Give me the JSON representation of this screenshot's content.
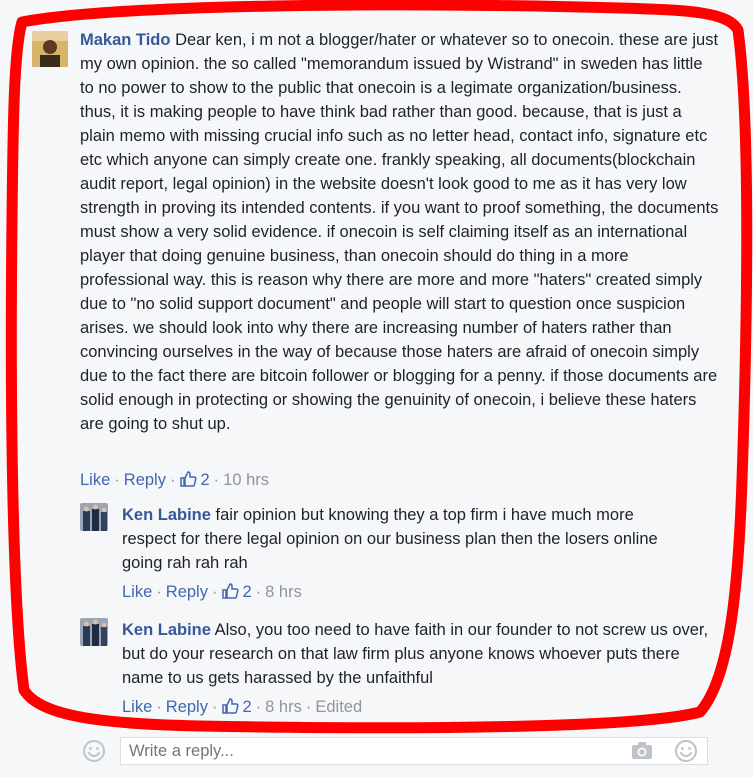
{
  "comments": [
    {
      "author": "Makan Tido",
      "text": "Dear ken, i m not a blogger/hater or whatever so to onecoin. these are just my own opinion. the so called \"memorandum issued by Wistrand\" in sweden has little to no power to show to the public that onecoin is a legimate organization/business. thus, it is making people to have think bad rather than good. because, that is just a plain memo with missing crucial info such as no letter head, contact info, signature etc etc which anyone can simply create one. frankly speaking, all documents(blockchain audit report, legal opinion) in the website doesn't look good to me as it has very low strength in proving its intended contents. if you want to proof something, the documents must show a very solid evidence. if onecoin is self claiming itself as an international player that doing genuine business, than onecoin should do thing in a more professional way. this is reason why there are more and more \"haters\" created simply due to \"no solid support document\" and people will start to question once suspicion arises. we should look into why there are increasing number of haters rather than convincing ourselves in the way of because those haters are afraid of onecoin simply due to the fact there are bitcoin follower or blogging for a penny. if those documents are solid enough in protecting or showing the genuinity of onecoin, i believe these haters are going to shut up.",
      "like": "Like",
      "reply": "Reply",
      "likes": "2",
      "time": "10 hrs",
      "edited": ""
    },
    {
      "author": "Ken Labine",
      "text": "fair opinion but knowing they a top firm i have much more respect for there legal opinion on our business plan then the losers online going rah rah rah",
      "like": "Like",
      "reply": "Reply",
      "likes": "2",
      "time": "8 hrs",
      "edited": ""
    },
    {
      "author": "Ken Labine",
      "text": "Also, you too need to have faith in our founder to not screw us over, but do your research on that law firm plus anyone knows whoever puts there name to us gets harassed by the unfaithful",
      "like": "Like",
      "reply": "Reply",
      "likes": "2",
      "time": "8 hrs",
      "edited": "Edited"
    }
  ],
  "reply_box": {
    "placeholder": "Write a reply..."
  },
  "icons": {
    "emoji": "smiley-icon",
    "camera": "camera-icon",
    "like": "thumbs-up-icon"
  },
  "colors": {
    "author": "#365899",
    "link": "#4267b2",
    "meta": "#90949c",
    "annotation": "#ff0000"
  }
}
